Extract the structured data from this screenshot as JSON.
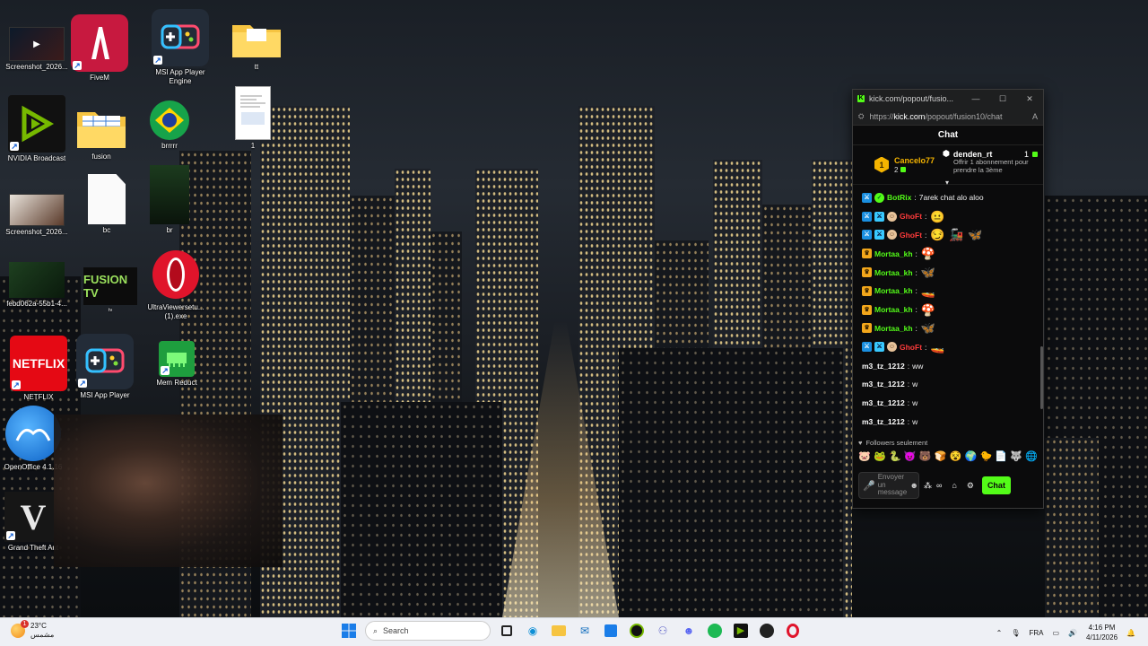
{
  "desktop": {
    "icons": [
      {
        "label": "Screenshot_2026...",
        "icon": "screenshot-thumbnail"
      },
      {
        "label": "FiveM",
        "icon": "fivem-icon"
      },
      {
        "label": "MSI App Player Engine",
        "icon": "msi-app-player-icon"
      },
      {
        "label": "tt",
        "icon": "folder-icon"
      },
      {
        "label": "NVIDIA Broadcast",
        "icon": "nvidia-broadcast-icon"
      },
      {
        "label": "fusion",
        "icon": "spreadsheet-folder-icon"
      },
      {
        "label": "brrrrr",
        "icon": "brazil-flag-icon"
      },
      {
        "label": "1",
        "icon": "document-thumbnail"
      },
      {
        "label": "Screenshot_2026...",
        "icon": "screenshot-thumbnail"
      },
      {
        "label": "bc",
        "icon": "blank-file-icon"
      },
      {
        "label": "br",
        "icon": "image-thumbnail"
      },
      {
        "label": "febd062a-55b1-4...",
        "icon": "image-thumbnail"
      },
      {
        "label": "FUSION TV",
        "icon": "fusion-tv-icon"
      },
      {
        "label": "UltraViewersetu...(1).exe",
        "icon": "opera-icon"
      },
      {
        "label": "NETFLIX",
        "icon": "netflix-icon"
      },
      {
        "label": "MSI App Player",
        "icon": "msi-app-player-icon"
      },
      {
        "label": "Mem Reduct",
        "icon": "mem-reduct-icon"
      },
      {
        "label": "OpenOffice 4.1.16",
        "icon": "openoffice-icon"
      },
      {
        "label": "Grand Theft Aut",
        "icon": "gta-v-icon"
      }
    ]
  },
  "popup": {
    "title": "kick.com/popout/fusio...",
    "url_prefix": "https://",
    "url_host": "kick.com",
    "url_path": "/popout/fusion10/chat",
    "chat_title": "Chat",
    "pinned": {
      "gifter_rank": "1",
      "gifter_name": "Cancelo77",
      "gifter_count": "2",
      "sub_user": "denden_rt",
      "sub_count": "1",
      "sub_desc": "Offrir 1 abonnement pour prendre la 3ème"
    },
    "messages": [
      {
        "user": "BotRix",
        "color": "#53fc18",
        "badges": [
          "blue",
          "green"
        ],
        "text": "7arek chat alo aloo",
        "emotes": []
      },
      {
        "user": "GhoFt",
        "color": "#ff3b3b",
        "badges": [
          "blue",
          "teal",
          "face"
        ],
        "text": "",
        "emotes": [
          "😐"
        ]
      },
      {
        "user": "GhoFt",
        "color": "#ff3b3b",
        "badges": [
          "blue",
          "teal",
          "face"
        ],
        "text": "",
        "emotes": [
          "😏",
          "🚂",
          "🦋"
        ]
      },
      {
        "user": "Mortaa_kh",
        "color": "#53fc18",
        "badges": [
          "gold"
        ],
        "text": "",
        "emotes": [
          "🍄"
        ]
      },
      {
        "user": "Mortaa_kh",
        "color": "#53fc18",
        "badges": [
          "gold"
        ],
        "text": "",
        "emotes": [
          "🦋"
        ]
      },
      {
        "user": "Mortaa_kh",
        "color": "#53fc18",
        "badges": [
          "gold"
        ],
        "text": "",
        "emotes": [
          "🚤"
        ]
      },
      {
        "user": "Mortaa_kh",
        "color": "#53fc18",
        "badges": [
          "gold"
        ],
        "text": "",
        "emotes": [
          "🍄"
        ]
      },
      {
        "user": "Mortaa_kh",
        "color": "#53fc18",
        "badges": [
          "gold"
        ],
        "text": "",
        "emotes": [
          "🦋"
        ]
      },
      {
        "user": "GhoFt",
        "color": "#ff3b3b",
        "badges": [
          "blue",
          "teal",
          "face"
        ],
        "text": "",
        "emotes": [
          "🚤"
        ]
      },
      {
        "user": "m3_tz_1212",
        "color": "#ffffff",
        "badges": [],
        "text": "ww",
        "emotes": []
      },
      {
        "user": "m3_tz_1212",
        "color": "#ffffff",
        "badges": [],
        "text": "w",
        "emotes": []
      },
      {
        "user": "m3_tz_1212",
        "color": "#ffffff",
        "badges": [],
        "text": "w",
        "emotes": []
      },
      {
        "user": "m3_tz_1212",
        "color": "#ffffff",
        "badges": [],
        "text": "w",
        "emotes": []
      }
    ],
    "followers_label": "Followers seulement",
    "emote_bar": [
      "🐷",
      "🐸",
      "🐍",
      "😈",
      "🐻",
      "🍞",
      "😵",
      "🌍",
      "🐤",
      "📄",
      "🐺",
      "🌐"
    ],
    "input_placeholder": "Envoyer un message",
    "chat_button": "Chat"
  },
  "taskbar": {
    "weather_temp": "23°C",
    "weather_desc": "مشمس",
    "weather_badge": "1",
    "search_placeholder": "Search",
    "language": "FRA",
    "time": "4:16 PM",
    "date": "4/11/2026"
  }
}
